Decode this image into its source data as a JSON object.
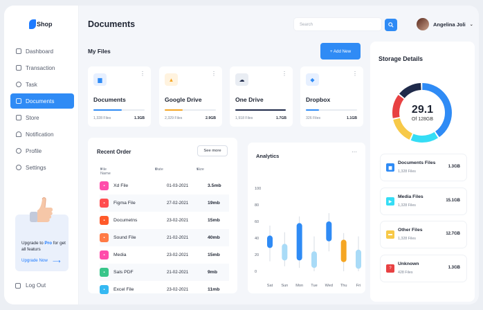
{
  "sidebar": {
    "logo": "Shop",
    "nav": [
      {
        "label": "Dashboard",
        "icon": "grid-icon",
        "active": false
      },
      {
        "label": "Transaction",
        "icon": "receipt-icon",
        "active": false
      },
      {
        "label": "Task",
        "icon": "clock-icon",
        "active": false
      },
      {
        "label": "Documents",
        "icon": "document-icon",
        "active": true
      },
      {
        "label": "Store",
        "icon": "bag-icon",
        "active": false
      },
      {
        "label": "Notification",
        "icon": "bell-icon",
        "active": false
      },
      {
        "label": "Profile",
        "icon": "user-icon",
        "active": false
      },
      {
        "label": "Settings",
        "icon": "gear-icon",
        "active": false
      }
    ],
    "upgrade": {
      "line1": "Upgrade to ",
      "pro": "Pro",
      "line2": " for get all featurs",
      "link": "Upgrade Now"
    },
    "logout": "Log Out"
  },
  "header": {
    "title": "Documents",
    "search_placeholder": "Search",
    "user_name": "Angelina Joli"
  },
  "my_files": {
    "label": "My Files",
    "add_button": "+ Add New",
    "cards": [
      {
        "name": "Documents",
        "files": "1,328 Files",
        "size": "1.3GB",
        "progress": 0.55,
        "color": "#2f8bf5",
        "icon_bg": "#e7f0ff",
        "icon": "document-icon"
      },
      {
        "name": "Google Drive",
        "files": "2,329 Files",
        "size": "2.9GB",
        "progress": 0.35,
        "color": "#f5a623",
        "icon_bg": "#fff3df",
        "icon": "drive-icon"
      },
      {
        "name": "One Drive",
        "files": "1,918 Files",
        "size": "1.7GB",
        "progress": 0.98,
        "color": "#1f2a4a",
        "icon_bg": "#e9edf3",
        "icon": "cloud-icon"
      },
      {
        "name": "Dropbox",
        "files": "326 Files",
        "size": "1.1GB",
        "progress": 0.25,
        "color": "#2f8bf5",
        "icon_bg": "#e7f0ff",
        "icon": "box-icon"
      }
    ]
  },
  "recent_order": {
    "title": "Recent Order",
    "see_more": "See more",
    "headers": {
      "name": "File Name",
      "date": "Date",
      "size": "Size"
    },
    "rows": [
      {
        "name": "Xd File",
        "date": "01-03-2021",
        "size": "3.5mb",
        "color": "#ff4dab",
        "icon": "xd-file-icon"
      },
      {
        "name": "Figma File",
        "date": "27-02-2021",
        "size": "19mb",
        "color": "#ff4d4f",
        "icon": "figma-file-icon"
      },
      {
        "name": "Documetns",
        "date": "23-02-2021",
        "size": "15mb",
        "color": "#ff5a2a",
        "icon": "doc-file-icon"
      },
      {
        "name": "Sound File",
        "date": "21-02-2021",
        "size": "40mb",
        "color": "#ff7a45",
        "icon": "sound-file-icon"
      },
      {
        "name": "Media",
        "date": "23-02-2021",
        "size": "15mb",
        "color": "#ff4dab",
        "icon": "media-file-icon"
      },
      {
        "name": "Sals PDF",
        "date": "21-02-2021",
        "size": "9mb",
        "color": "#38c58a",
        "icon": "pdf-file-icon"
      },
      {
        "name": "Excel File",
        "date": "23-02-2021",
        "size": "11mb",
        "color": "#35b8f2",
        "icon": "excel-file-icon"
      }
    ]
  },
  "analytics": {
    "title": "Analytics",
    "yticks": [
      0,
      20,
      40,
      60,
      80,
      100
    ],
    "days": [
      "Sat",
      "Sun",
      "Mon",
      "Tue",
      "Wed",
      "Thu",
      "Fri"
    ],
    "series": [
      {
        "day": "Sat",
        "low": 12,
        "high": 55,
        "open": 28,
        "close": 43,
        "color": "#2f8bf5"
      },
      {
        "day": "Sun",
        "low": 6,
        "high": 47,
        "open": 13,
        "close": 33,
        "color": "#a9dbf7"
      },
      {
        "day": "Mon",
        "low": 4,
        "high": 66,
        "open": 13,
        "close": 58,
        "color": "#2f8bf5"
      },
      {
        "day": "Tue",
        "low": 0,
        "high": 42,
        "open": 4,
        "close": 24,
        "color": "#a9dbf7"
      },
      {
        "day": "Wed",
        "low": 24,
        "high": 70,
        "open": 36,
        "close": 60,
        "color": "#2f8bf5"
      },
      {
        "day": "Thu",
        "low": 0,
        "high": 46,
        "open": 11,
        "close": 38,
        "color": "#f5a623"
      },
      {
        "day": "Fri",
        "low": 0,
        "high": 42,
        "open": 3,
        "close": 26,
        "color": "#a9dbf7"
      }
    ]
  },
  "storage": {
    "title": "Storage Details",
    "used": "29.1",
    "total": "Of 128GB",
    "donut": [
      {
        "value": 0.41,
        "color": "#2f8bf5"
      },
      {
        "value": 0.16,
        "color": "#35ddf5"
      },
      {
        "value": 0.15,
        "color": "#f7c948"
      },
      {
        "value": 0.14,
        "color": "#e84142"
      },
      {
        "value": 0.14,
        "color": "#1f2a4a"
      }
    ],
    "items": [
      {
        "name": "Documents Files",
        "files": "1,328 Files",
        "size": "1.3GB",
        "color": "#2f8bf5",
        "icon": "document-icon"
      },
      {
        "name": "Media Files",
        "files": "1,328 Files",
        "size": "15.1GB",
        "color": "#35ddf5",
        "icon": "play-icon"
      },
      {
        "name": "Other Files",
        "files": "1,328 Files",
        "size": "12.7GB",
        "color": "#f7c948",
        "icon": "folder-icon"
      },
      {
        "name": "Unknown",
        "files": "428 Files",
        "size": "1.3GB",
        "color": "#e84142",
        "icon": "unknown-file-icon"
      }
    ]
  }
}
